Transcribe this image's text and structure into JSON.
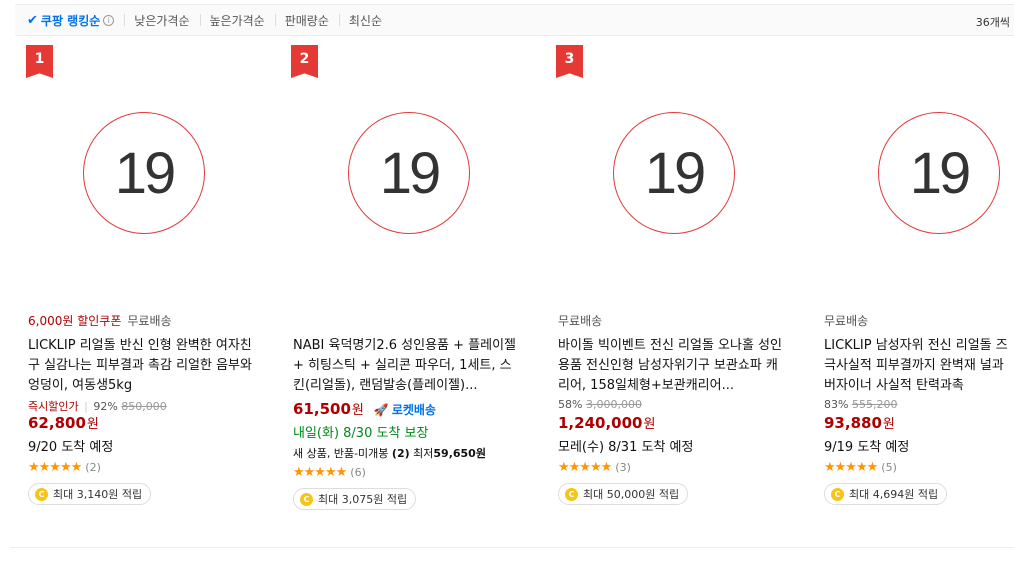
{
  "sort": {
    "items": [
      "쿠팡 랭킹순",
      "낮은가격순",
      "높은가격순",
      "판매량순",
      "최신순"
    ],
    "info_icon": "i",
    "count": "36개씩"
  },
  "products": [
    {
      "rank": "1",
      "age_label": "19",
      "coupon": "6,000원 할인쿠폰",
      "shipping": "무료배송",
      "name": "LICKLIP 리얼돌 반신 인형 완벽한 여자친구 실감나는 피부결과 촉감 리얼한 음부와 엉덩이, 여동생5kg",
      "discount_label": "즉시할인가",
      "discount_sep": "|",
      "discount_rate": "92%",
      "original_price": "850,000",
      "price": "62,800",
      "currency": "원",
      "arrival": "9/20 도착 예정",
      "stars": "★★★★★",
      "rating_count": "(2)",
      "reward": "최대 3,140원 적립"
    },
    {
      "rank": "2",
      "age_label": "19",
      "name": "NABI 육덕명기2.6 성인용품 + 플레이젤 + 히팅스틱 + 실리콘 파우더, 1세트, 스킨(리얼돌), 랜덤발송(플레이젤)...",
      "price": "61,500",
      "currency": "원",
      "rocket": "로켓배송",
      "arrival": "내일(화) 8/30 도착 보장",
      "used_prefix": "새 상품, 반품-미개봉",
      "used_count": "(2)",
      "used_min_label": "최저",
      "used_min": "59,650원",
      "stars": "★★★★★",
      "rating_count": "(6)",
      "reward": "최대 3,075원 적립"
    },
    {
      "rank": "3",
      "age_label": "19",
      "shipping": "무료배송",
      "name": "바이돌 빅이벤트 전신 리얼돌 오나홀 성인용품 전신인형 남성자위기구 보관쇼파 캐리어, 158일체형+보관캐리어...",
      "discount_rate": "58%",
      "original_price": "3,000,000",
      "price": "1,240,000",
      "currency": "원",
      "arrival": "모레(수) 8/31 도착 예정",
      "stars": "★★★★★",
      "rating_count": "(3)",
      "reward": "최대 50,000원 적립"
    },
    {
      "age_label": "19",
      "shipping": "무료배송",
      "name": "LICKLIP 남성자위 전신 리얼돌 즈 극사실적 피부결까지 완벽재 널과 버자이너 사실적 탄력과촉",
      "discount_rate": "83%",
      "original_price": "555,200",
      "price": "93,880",
      "currency": "원",
      "arrival": "9/19 도착 예정",
      "stars": "★★★★★",
      "rating_count": "(5)",
      "reward": "최대 4,694원 적립"
    }
  ],
  "colors": {
    "accent_blue": "#0073e9",
    "price_red": "#ae0000",
    "badge_red": "#e53935",
    "star_orange": "#ff9500",
    "arrival_green": "#00891a"
  },
  "icons": [
    "check-icon",
    "info-icon",
    "rank-badge",
    "age-restricted-icon",
    "rocket-icon",
    "coin-icon",
    "star-icon"
  ]
}
